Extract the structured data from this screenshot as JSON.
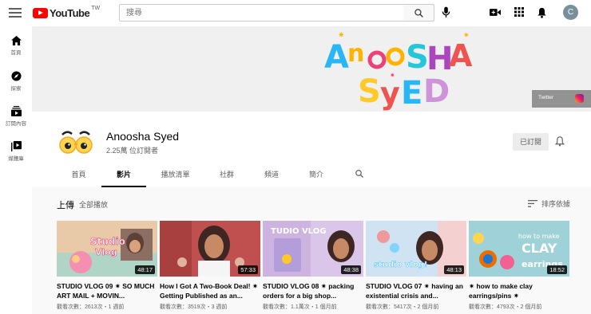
{
  "topbar": {
    "logo_text": "YouTube",
    "country": "TW",
    "search_placeholder": "搜尋",
    "avatar_letter": "C",
    "icons": [
      "menu-icon",
      "search-icon",
      "mic-icon",
      "create-video-icon",
      "apps-icon",
      "notifications-icon"
    ]
  },
  "sidebar": {
    "items": [
      {
        "label": "首頁",
        "icon": "home-icon"
      },
      {
        "label": "探索",
        "icon": "explore-icon"
      },
      {
        "label": "訂閱內容",
        "icon": "subscriptions-icon"
      },
      {
        "label": "媒體庫",
        "icon": "library-icon"
      }
    ]
  },
  "banner": {
    "art_text": "ANOOSHA SYED",
    "link_twitter": "Twitter",
    "link_instagram_icon": "instagram-icon"
  },
  "channel": {
    "name": "Anoosha Syed",
    "subscribers": "2.25萬 位訂閱者",
    "subscribe_label": "已訂閱",
    "tabs": [
      "首頁",
      "影片",
      "播放清單",
      "社群",
      "頻道",
      "簡介"
    ],
    "active_tab": "影片"
  },
  "section": {
    "title": "上傳",
    "play_all": "全部播放",
    "sort_label": "排序依據"
  },
  "videos": [
    {
      "title": "STUDIO VLOG 09 ✷ SO MUCH ART MAIL + MOVIN...",
      "meta": "觀看次數：2613次・1 週前",
      "duration": "48:17"
    },
    {
      "title": "How I Got A Two-Book Deal! ✷ Getting Published as an...",
      "meta": "觀看次數：3519次・3 週前",
      "duration": "57:33"
    },
    {
      "title": "STUDIO VLOG 08 ✷ packing orders for a big shop...",
      "meta": "觀看次數：1.1萬次・1 個月前",
      "duration": "48:38"
    },
    {
      "title": "STUDIO VLOG 07 ✷ having an existential crisis and...",
      "meta": "觀看次數：5417次・2 個月前",
      "duration": "48:13"
    },
    {
      "title": "✷ how to make clay earrings/pins ✷",
      "meta": "觀看次數：4793次・2 個月前",
      "duration": "18:52"
    }
  ],
  "colors": {
    "youtube_red": "#ff0000",
    "banner_bg": "#f0f0f0"
  }
}
